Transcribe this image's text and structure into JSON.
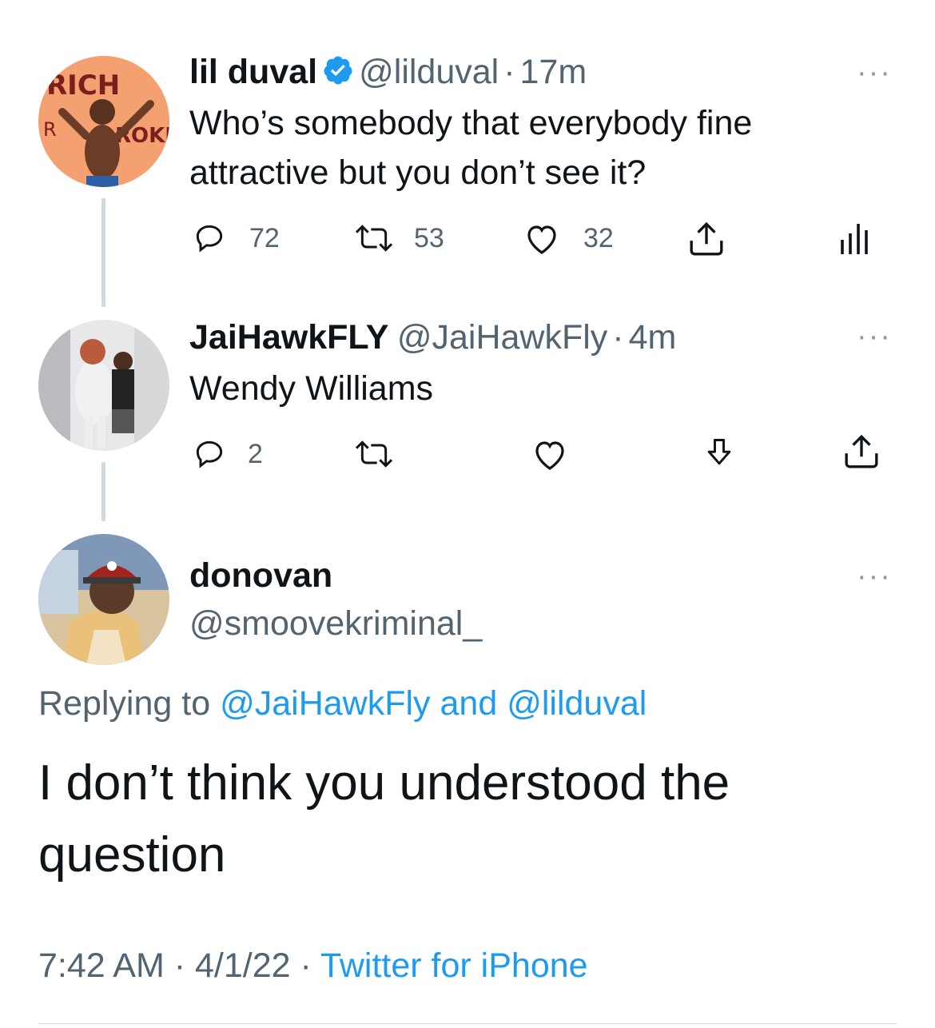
{
  "tweet1": {
    "name": "lil duval",
    "handle": "@lilduval",
    "sep": "·",
    "time": "17m",
    "text_line1": "Who’s somebody that everybody fine",
    "text_line2": "attractive but you don’t see it?",
    "replies": "72",
    "retweets": "53",
    "likes": "32",
    "more": "···"
  },
  "tweet2": {
    "name": "JaiHawkFLY",
    "handle": "@JaiHawkFly",
    "sep": "·",
    "time": "4m",
    "text": "Wendy Williams",
    "replies": "2",
    "more": "···"
  },
  "tweet3": {
    "name": "donovan",
    "handle": "@smoovekriminal_",
    "more": "···",
    "replying_prefix": "Replying to ",
    "reply_user1": "@JaiHawkFly",
    "reply_and": " and ",
    "reply_user2": "@lilduval",
    "text_line1": "I don’t think you understood the",
    "text_line2": "question",
    "time": "7:42 AM",
    "date": "4/1/22",
    "sep": " · ",
    "source": "Twitter for iPhone"
  },
  "colors": {
    "accent": "#1d9bf0",
    "secondary": "#536471",
    "line": "#cfd9de"
  }
}
